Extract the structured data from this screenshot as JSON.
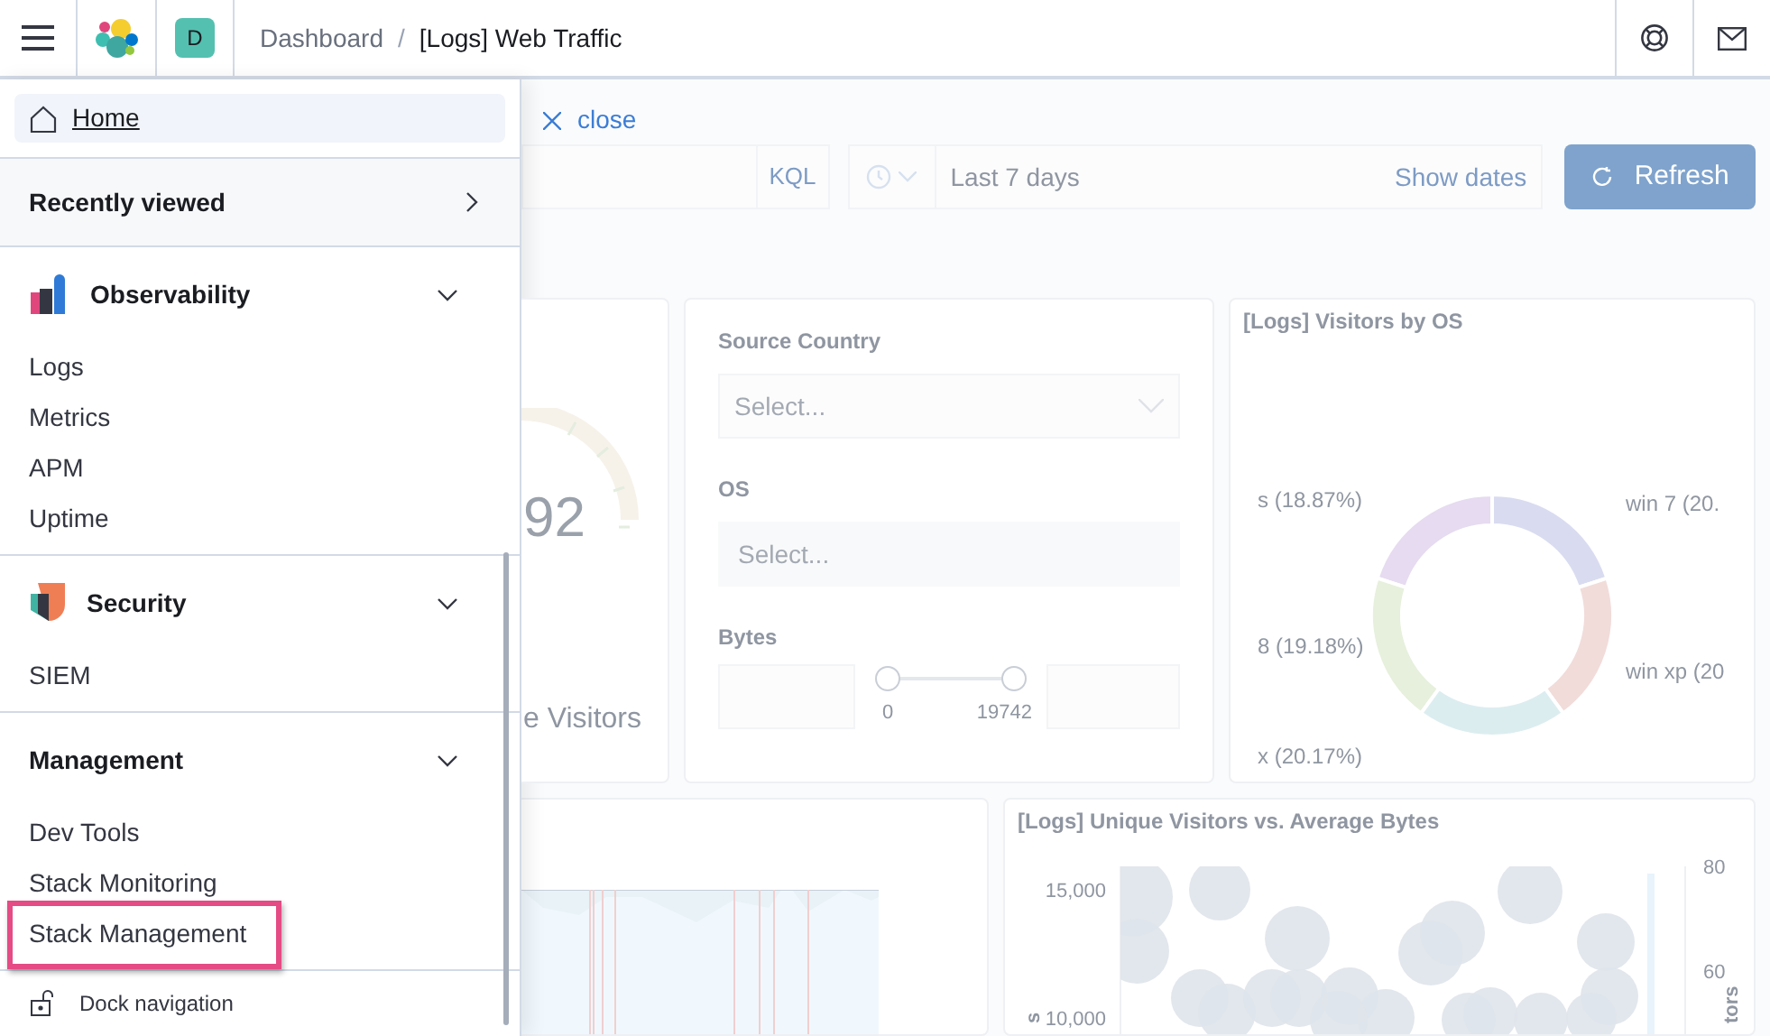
{
  "header": {
    "avatar": "D",
    "separator": "/",
    "breadcrumbs": [
      {
        "label": "Dashboard",
        "current": false
      },
      {
        "label": "[Logs] Web Traffic",
        "current": true
      }
    ]
  },
  "nav": {
    "home": {
      "label": "Home",
      "selected": true
    },
    "recently_viewed": {
      "label": "Recently viewed",
      "expanded": false
    },
    "groups": [
      {
        "kind": "observability",
        "title": "Observability",
        "expanded": true,
        "items": [
          {
            "label": "Logs",
            "highlighted": false
          },
          {
            "label": "Metrics",
            "highlighted": false
          },
          {
            "label": "APM",
            "highlighted": false
          },
          {
            "label": "Uptime",
            "highlighted": false
          }
        ]
      },
      {
        "kind": "security",
        "title": "Security",
        "expanded": true,
        "items": [
          {
            "label": "SIEM",
            "highlighted": false
          }
        ]
      },
      {
        "kind": "management",
        "title": "Management",
        "expanded": true,
        "items": [
          {
            "label": "Dev Tools",
            "highlighted": false
          },
          {
            "label": "Stack Monitoring",
            "highlighted": false
          },
          {
            "label": "Stack Management",
            "highlighted": true
          }
        ]
      }
    ],
    "dock": "Dock navigation"
  },
  "close_link": "close",
  "query_bar": {
    "language": "KQL",
    "time_range": "Last 7 days",
    "show_dates": "Show dates",
    "refresh": "Refresh"
  },
  "gauge_panel": {
    "value": "92",
    "label": "e Visitors"
  },
  "controls_panel": {
    "fields": [
      {
        "kind": "select",
        "label": "Source Country",
        "placeholder": "Select..."
      },
      {
        "kind": "combo",
        "label": "OS",
        "placeholder": "Select..."
      }
    ],
    "range": {
      "label": "Bytes",
      "min": "0",
      "max": "19742",
      "thumbs": [
        {
          "level": 0
        },
        {
          "level": 1
        }
      ]
    }
  },
  "os_panel": {
    "title": "[Logs] Visitors by OS",
    "slices": [
      {
        "label": "s (18.87%)",
        "color": "#e6dbf0"
      },
      {
        "label": "win 7 (20.",
        "color": "#d9dcf0"
      },
      {
        "label": "8 (19.18%)",
        "color": "#e6f0dc"
      },
      {
        "label": "win xp (20",
        "color": "#f1dcda"
      },
      {
        "label": "x (20.17%)",
        "color": "#dcedf0"
      }
    ]
  },
  "bubble_panel": {
    "title": "[Logs] Unique Visitors vs. Average Bytes",
    "yticks": [
      "15,000",
      "10,000"
    ],
    "y2ticks": [
      "80",
      "60"
    ],
    "ylabel": "s",
    "y2label": "tors"
  }
}
